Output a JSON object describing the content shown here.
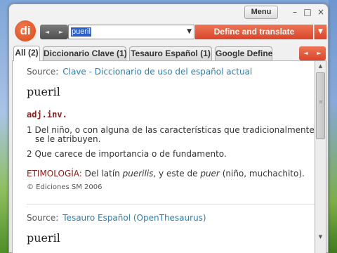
{
  "window": {
    "menu_label": "Menu",
    "controls": {
      "minimize": "–",
      "maximize": "□",
      "close": "×"
    }
  },
  "logo": {
    "text": "di"
  },
  "toolbar": {
    "back": "◄",
    "forward": "►",
    "search_value": "pueril",
    "dropdown": "▼",
    "define_label": "Define and translate",
    "define_dropdown": "▼"
  },
  "tabs": [
    {
      "label": "All (2)",
      "active": true
    },
    {
      "label": "Diccionario Clave (1)"
    },
    {
      "label": "Tesauro Español (1)"
    },
    {
      "label": "Google Define"
    }
  ],
  "tab_nav": {
    "prev": "◄",
    "next": "►"
  },
  "entries": [
    {
      "source_label": "Source:",
      "source_name": "Clave - Diccionario de uso del español actual",
      "headword": "pueril",
      "pos": "adj.inv.",
      "senses": [
        {
          "number": "1",
          "text": "Del niño, o con alguna de las características que tradicionalmente",
          "text_cont": "se le atribuyen."
        },
        {
          "number": "2",
          "text": "Que carece de importancia o de fundamento."
        }
      ],
      "etymology": {
        "label": "ETIMOLOGÍA:",
        "pre": "Del latín",
        "word1": "puerilis",
        "mid": ", y este de",
        "word2": "puer",
        "post": "(niño, muchachito)."
      },
      "copyright": "© Ediciones SM 2006"
    },
    {
      "source_label": "Source:",
      "source_name": "Tesauro Español (OpenThesaurus)",
      "headword": "pueril"
    }
  ],
  "scrollbar": {
    "up": "▲",
    "down": "▼",
    "grip": "≡"
  },
  "colors": {
    "accent": "#d9452a",
    "link": "#2a7fb0",
    "pos": "#8a1c1c",
    "selection": "#2b5fc9"
  },
  "icons": [
    "back-arrow-icon",
    "forward-arrow-icon",
    "chevron-down-icon",
    "minimize-icon",
    "maximize-icon",
    "close-icon"
  ]
}
